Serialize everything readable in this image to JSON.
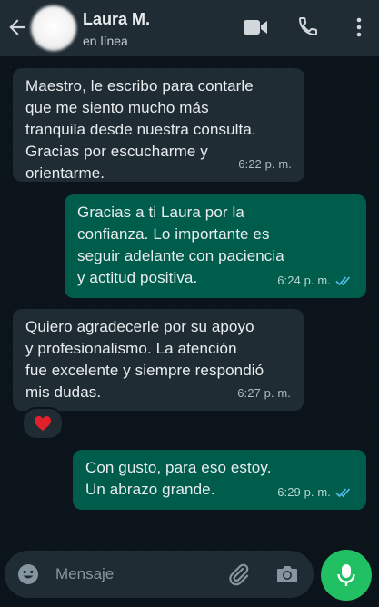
{
  "header": {
    "contact_name": "Laura M.",
    "status": "en línea"
  },
  "messages": [
    {
      "direction": "incoming",
      "text": "Maestro, le escribo para contarle\nque me siento mucho más\ntranquila desde nuestra consulta.\nGracias por escucharme y\norientarme.",
      "time": "6:22 p. m."
    },
    {
      "direction": "outgoing",
      "text": "Gracias a ti Laura por la\nconfianza. Lo importante es\nseguir adelante con paciencia\ny actitud positiva.",
      "time": "6:24 p. m.",
      "read": true
    },
    {
      "direction": "incoming",
      "text": "Quiero agradecerle por su apoyo\ny profesionalismo. La atención\nfue excelente y siempre respondió\nmis dudas.",
      "time": "6:27 p. m.",
      "reaction": "❤️"
    },
    {
      "direction": "outgoing",
      "text": "Con gusto, para eso estoy.\nUn abrazo grande.",
      "time": "6:29 p. m.",
      "read": true
    }
  ],
  "composer": {
    "placeholder": "Mensaje"
  },
  "colors": {
    "header_bg": "#1f2c34",
    "chat_bg": "#0b141a",
    "incoming_bubble": "#1f2c34",
    "outgoing_bubble": "#005c4b",
    "read_ticks": "#53bdeb",
    "mic_button": "#21c063"
  },
  "icons": [
    "back-arrow-icon",
    "video-call-icon",
    "phone-icon",
    "more-vert-icon",
    "emoji-icon",
    "attach-icon",
    "camera-icon",
    "mic-icon",
    "double-check-icon",
    "heart-icon"
  ]
}
